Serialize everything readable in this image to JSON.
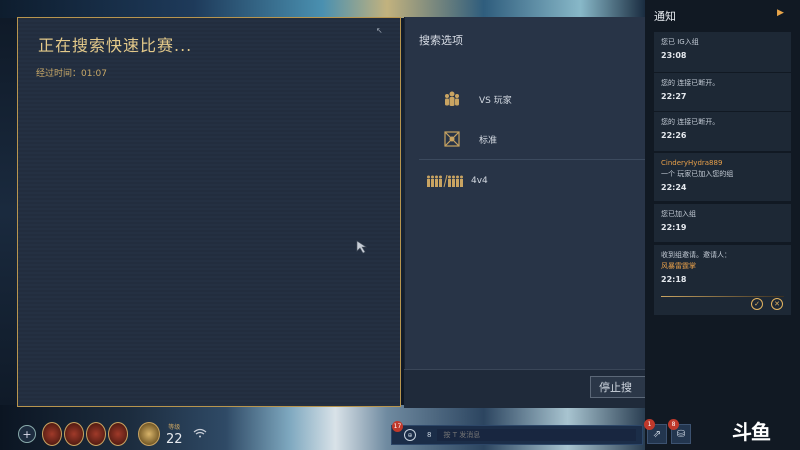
{
  "search": {
    "title": "正在搜索快速比赛...",
    "elapsed": "经过时间：01:07"
  },
  "options": {
    "header": "搜索选项",
    "items": [
      {
        "label": "VS 玩家",
        "icon": "players-icon"
      },
      {
        "label": "标准",
        "icon": "standard-mode-icon"
      },
      {
        "label": "4v4",
        "icon": "team-size-icon"
      }
    ],
    "stop_label": "停止搜"
  },
  "notifications": {
    "header": "通知",
    "items": [
      {
        "text": "您已 IG入组",
        "time": "23:08"
      },
      {
        "text": "您的 连接已断开。",
        "time": "22:27"
      },
      {
        "text": "您的 连接已断开。",
        "time": "22:26"
      },
      {
        "name": "CinderyHydra889",
        "text": "一个 玩家已加入您的组",
        "time": "22:24"
      },
      {
        "text": "您已加入组",
        "time": "22:19"
      },
      {
        "text": "收到组邀请。邀请人：",
        "sub": "风暴雷霆掌",
        "time": "22:18"
      }
    ]
  },
  "bottom": {
    "level_label": "等级",
    "level": "22",
    "chat_badge": "17",
    "chat_count": "8",
    "chat_placeholder": "按 T 发消息",
    "tray_badges": [
      "1",
      "8"
    ]
  },
  "watermark": "斗鱼",
  "colors": {
    "accent_gold": "#c9a462",
    "panel_bg": "#243042",
    "notif_bg": "#1d2835",
    "badge_red": "#c0392b"
  }
}
